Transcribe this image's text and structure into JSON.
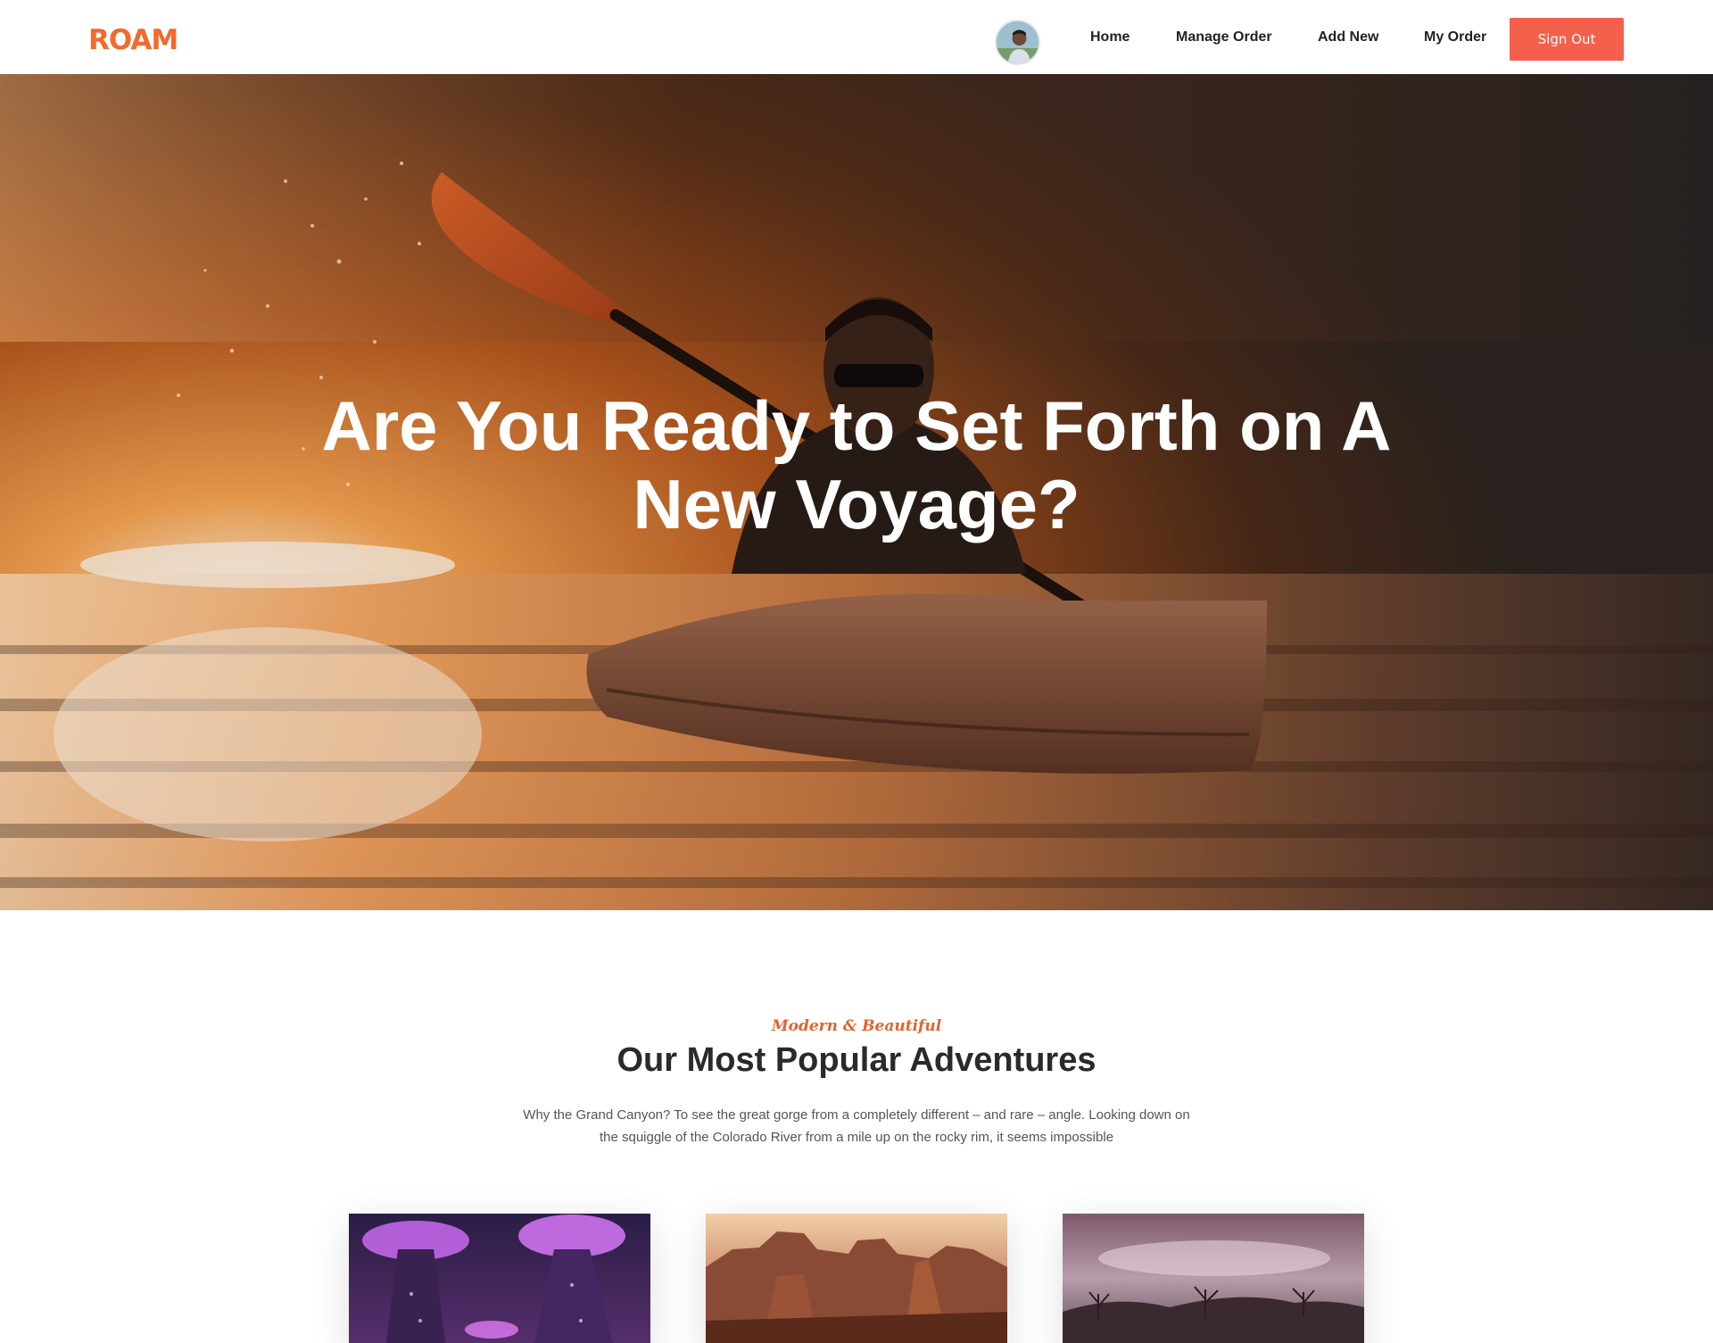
{
  "nav": {
    "brand": "ROAM",
    "links": [
      "Home",
      "Manage Order",
      "Add New",
      "My Order"
    ],
    "signout_label": "Sign Out",
    "accent": "#f36a2a",
    "button_color": "#f4604b"
  },
  "hero": {
    "title": "Are You Ready to Set Forth on A New Voyage?"
  },
  "section": {
    "subtitle": "Modern & Beautiful",
    "title": "Our Most Popular Adventures",
    "description": "Why the Grand Canyon? To see the great gorge from a completely different – and rare – angle. Looking down on the squiggle of the Colorado River from a mile up on the rocky rim, it seems impossible"
  }
}
